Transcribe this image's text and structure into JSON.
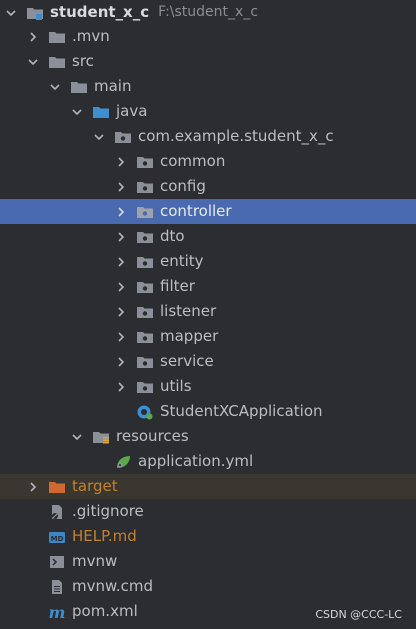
{
  "project": {
    "name": "student_x_c",
    "path": "F:\\student_x_c"
  },
  "tree": {
    "mvn": ".mvn",
    "src": "src",
    "main": "main",
    "java": "java",
    "package": "com.example.student_x_c",
    "pkgs": [
      "common",
      "config",
      "controller",
      "dto",
      "entity",
      "filter",
      "listener",
      "mapper",
      "service",
      "utils"
    ],
    "app_class": "StudentXCApplication",
    "resources": "resources",
    "app_yml": "application.yml",
    "target": "target",
    "gitignore": ".gitignore",
    "help": "HELP.md",
    "mvnw": "mvnw",
    "mvnw_cmd": "mvnw.cmd",
    "pom": "pom.xml"
  },
  "selected_item": "controller",
  "watermark": "CSDN @CCC-LC",
  "colors": {
    "background": "#2b2d30",
    "selection": "#4a6ab0",
    "excluded_text": "#c2822b",
    "folder": "#8a8f98",
    "source_folder": "#3d8fd1",
    "target_folder": "#d0682f"
  }
}
